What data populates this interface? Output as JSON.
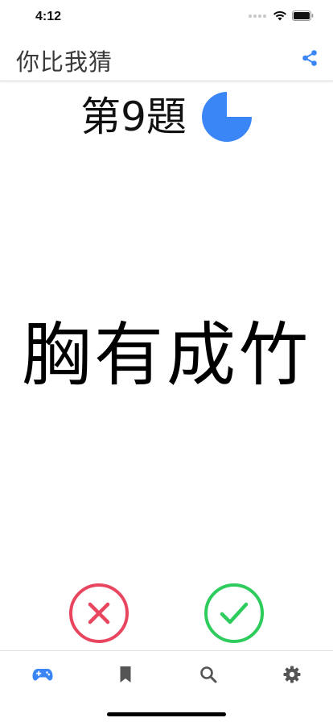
{
  "status_bar": {
    "time": "4:12"
  },
  "header": {
    "title": "你比我猜",
    "share_icon": "share-icon"
  },
  "question": {
    "label": "第9題",
    "timer_icon": "timer-pie-icon",
    "timer_remaining_fraction": 0.75
  },
  "idiom": {
    "text": "胸有成竹"
  },
  "actions": {
    "wrong_icon": "close-icon",
    "correct_icon": "checkmark-icon"
  },
  "tabs": [
    {
      "icon": "gamepad-icon",
      "active": true
    },
    {
      "icon": "bookmark-icon",
      "active": false
    },
    {
      "icon": "search-icon",
      "active": false
    },
    {
      "icon": "gear-icon",
      "active": false
    }
  ],
  "colors": {
    "accent": "#3b86f6",
    "wrong": "#e8465f",
    "correct": "#2ecc5c",
    "inactive_tab": "#555555"
  }
}
